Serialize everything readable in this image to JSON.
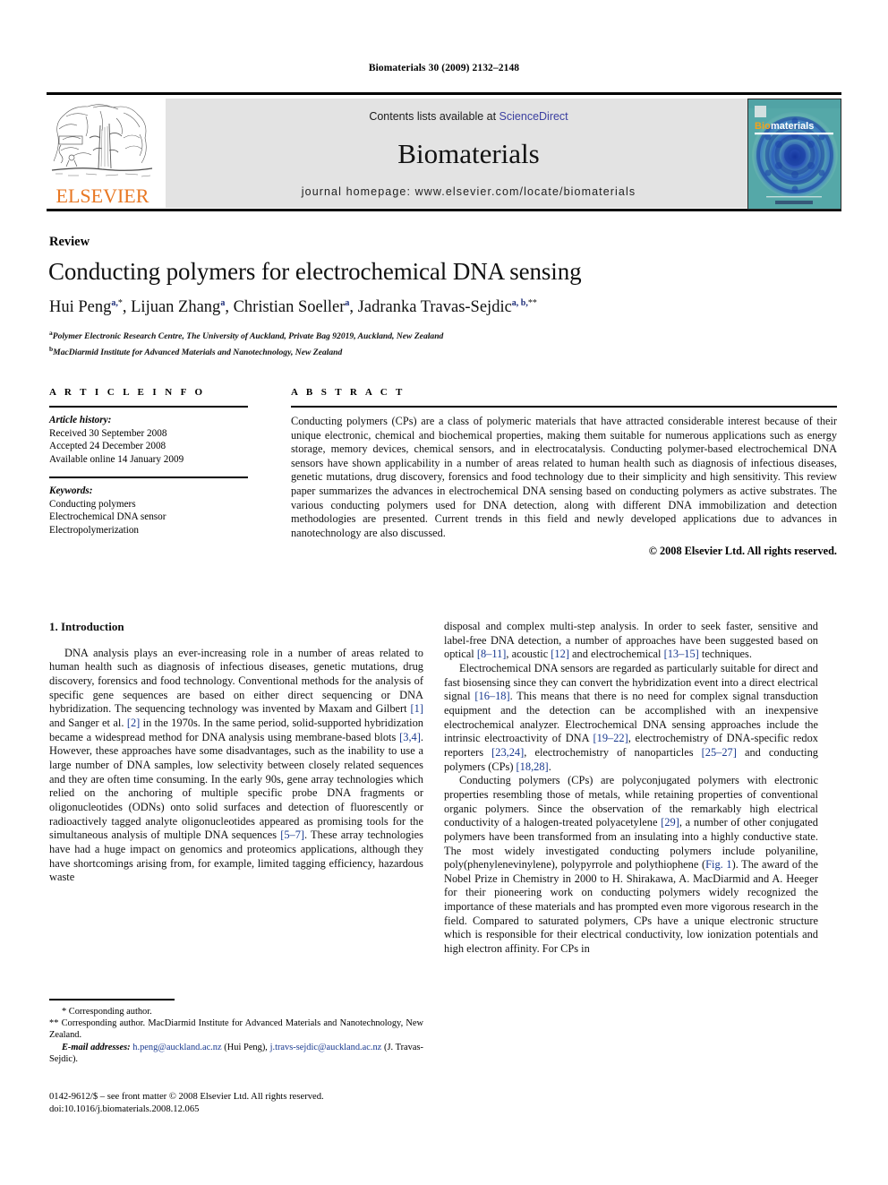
{
  "running_head": "Biomaterials 30 (2009) 2132–2148",
  "masthead": {
    "contents_prefix": "Contents lists available at ",
    "sciencedirect": "ScienceDirect",
    "journal_name": "Biomaterials",
    "homepage": "journal homepage: www.elsevier.com/locate/biomaterials",
    "publisher_wordmark": "ELSEVIER",
    "cover_title_a": "Bio",
    "cover_title_b": "materials",
    "accent_orange": "#E87722",
    "link_blue": "#3b3fa0",
    "band_grey": "#e3e3e3",
    "cover_teal": "#4aa6a8",
    "cover_blue": "#1c3fa8"
  },
  "article": {
    "kicker": "Review",
    "title": "Conducting polymers for electrochemical DNA sensing",
    "authors_html": "Hui Peng<sup>a,</sup><sup class=\"star\">*</sup>, Lijuan Zhang<sup>a</sup>, Christian Soeller<sup>a</sup>, Jadranka Travas-Sejdic<sup>a, b,</sup><sup class=\"star\">**</sup>",
    "affiliations": [
      {
        "marker": "a",
        "text": "Polymer Electronic Research Centre, The University of Auckland, Private Bag 92019, Auckland, New Zealand"
      },
      {
        "marker": "b",
        "text": "MacDiarmid Institute for Advanced Materials and Nanotechnology, New Zealand"
      }
    ]
  },
  "info": {
    "heading": "A R T I C L E  I N F O",
    "history_label": "Article history:",
    "history": [
      "Received 30 September 2008",
      "Accepted 24 December 2008",
      "Available online 14 January 2009"
    ],
    "keywords_label": "Keywords:",
    "keywords": [
      "Conducting polymers",
      "Electrochemical DNA sensor",
      "Electropolymerization"
    ]
  },
  "abstract": {
    "heading": "A B S T R A C T",
    "body": "Conducting polymers (CPs) are a class of polymeric materials that have attracted considerable interest because of their unique electronic, chemical and biochemical properties, making them suitable for numerous applications such as energy storage, memory devices, chemical sensors, and in electrocatalysis. Conducting polymer-based electrochemical DNA sensors have shown applicability in a number of areas related to human health such as diagnosis of infectious diseases, genetic mutations, drug discovery, forensics and food technology due to their simplicity and high sensitivity. This review paper summarizes the advances in electrochemical DNA sensing based on conducting polymers as active substrates. The various conducting polymers used for DNA detection, along with different DNA immobilization and detection methodologies are presented. Current trends in this field and newly developed applications due to advances in nanotechnology are also discussed.",
    "copyright": "© 2008 Elsevier Ltd. All rights reserved."
  },
  "body": {
    "section_number_title": "1. Introduction",
    "left_paragraphs": [
      "DNA analysis plays an ever-increasing role in a number of areas related to human health such as diagnosis of infectious diseases, genetic mutations, drug discovery, forensics and food technology. Conventional methods for the analysis of specific gene sequences are based on either direct sequencing or DNA hybridization. The sequencing technology was invented by Maxam and Gilbert [1] and Sanger et al. [2] in the 1970s. In the same period, solid-supported hybridization became a widespread method for DNA analysis using membrane-based blots [3,4]. However, these approaches have some disadvantages, such as the inability to use a large number of DNA samples, low selectivity between closely related sequences and they are often time consuming. In the early 90s, gene array technologies which relied on the anchoring of multiple specific probe DNA fragments or oligonucleotides (ODNs) onto solid surfaces and detection of fluorescently or radioactively tagged analyte oligonucleotides appeared as promising tools for the simultaneous analysis of multiple DNA sequences [5–7]. These array technologies have had a huge impact on genomics and proteomics applications, although they have shortcomings arising from, for example, limited tagging efficiency, hazardous waste"
    ],
    "right_paragraphs": [
      "disposal and complex multi-step analysis. In order to seek faster, sensitive and label-free DNA detection, a number of approaches have been suggested based on optical [8–11], acoustic [12] and electrochemical [13–15] techniques.",
      "Electrochemical DNA sensors are regarded as particularly suitable for direct and fast biosensing since they can convert the hybridization event into a direct electrical signal [16–18]. This means that there is no need for complex signal transduction equipment and the detection can be accomplished with an inexpensive electrochemical analyzer. Electrochemical DNA sensing approaches include the intrinsic electroactivity of DNA [19–22], electrochemistry of DNA-specific redox reporters [23,24], electrochemistry of nanoparticles [25–27] and conducting polymers (CPs) [18,28].",
      "Conducting polymers (CPs) are polyconjugated polymers with electronic properties resembling those of metals, while retaining properties of conventional organic polymers. Since the observation of the remarkably high electrical conductivity of a halogen-treated polyacetylene [29], a number of other conjugated polymers have been transformed from an insulating into a highly conductive state. The most widely investigated conducting polymers include polyaniline, poly(phenylenevinylene), polypyrrole and polythiophene (Fig. 1). The award of the Nobel Prize in Chemistry in 2000 to H. Shirakawa, A. MacDiarmid and A. Heeger for their pioneering work on conducting polymers widely recognized the importance of these materials and has prompted even more vigorous research in the field. Compared to saturated polymers, CPs have a unique electronic structure which is responsible for their electrical conductivity, low ionization potentials and high electron affinity. For CPs in"
    ]
  },
  "footnotes": {
    "star_note": "* Corresponding author.",
    "doublestar_note": "** Corresponding author. MacDiarmid Institute for Advanced Materials and Nanotechnology, New Zealand.",
    "email_label": "E-mail addresses:",
    "email_1": "h.peng@auckland.ac.nz",
    "email_1_owner": "(Hui Peng),",
    "email_2": "j.travs-sejdic@auckland.ac.nz",
    "email_2_owner": "(J. Travas-Sejdic)."
  },
  "imprint": {
    "line1": "0142-9612/$ – see front matter © 2008 Elsevier Ltd. All rights reserved.",
    "line2": "doi:10.1016/j.biomaterials.2008.12.065"
  }
}
